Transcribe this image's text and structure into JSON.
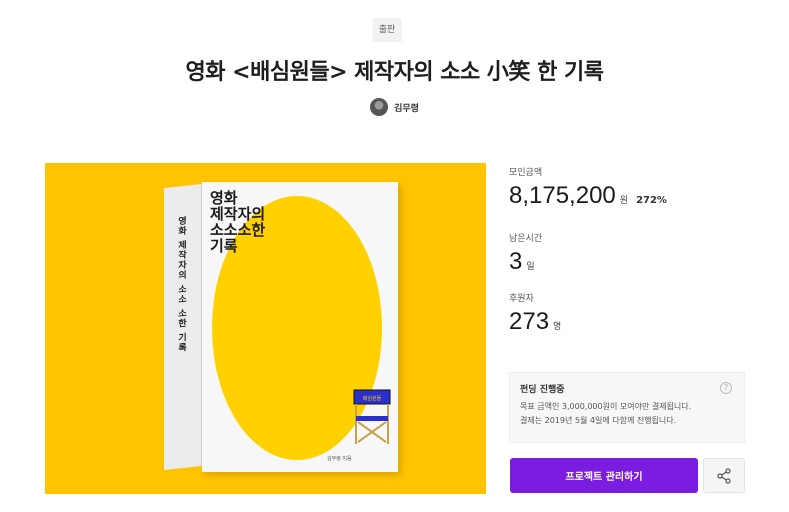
{
  "category": "출판",
  "title": "영화 <배심원들> 제작자의 소소 小笑 한 기록",
  "creator": {
    "name": "김무령"
  },
  "book": {
    "cover_title": "영화\n제작자의\n소소소한\n기록",
    "spine_text": "영화 제작자의 소소 소한 기록",
    "author_small": "김무령 지음",
    "chair_label": "배심원들"
  },
  "stats": {
    "amount": {
      "label": "모인금액",
      "value": "8,175,200",
      "unit": "원",
      "percent": "272%"
    },
    "time_left": {
      "label": "남은시간",
      "value": "3",
      "unit": "일"
    },
    "backers": {
      "label": "후원자",
      "value": "273",
      "unit": "명"
    }
  },
  "funding": {
    "title": "펀딩 진행중",
    "line1": "목표 금액인 3,000,000원이 모여야만 결제됩니다.",
    "line2": "결제는 2019년 5월 4일에 다함께 진행됩니다."
  },
  "buttons": {
    "manage": "프로젝트 관리하기"
  },
  "colors": {
    "accent": "#7a1de0",
    "hero_bg": "#ffc300"
  },
  "icons": [
    "help-icon",
    "share-icon"
  ]
}
